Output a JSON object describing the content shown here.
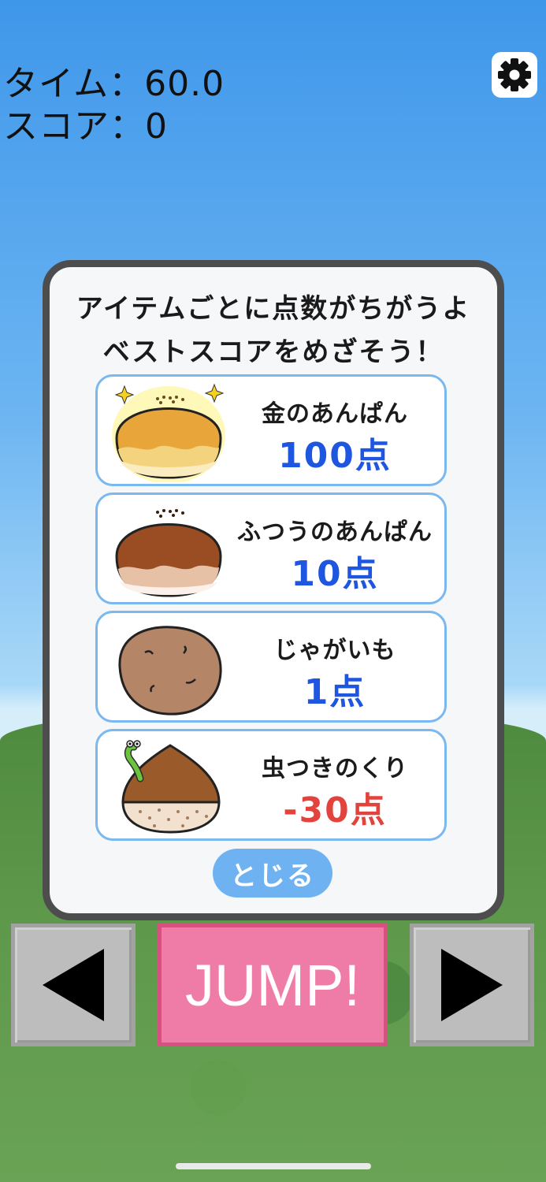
{
  "hud": {
    "time_label": "タイム：60.0",
    "score_label": "スコア：0"
  },
  "settings": {
    "icon": "gear-icon"
  },
  "modal": {
    "heading_line1": "アイテムごとに点数がちがうよ",
    "heading_line2": "ベストスコアをめざそう！",
    "items": [
      {
        "name": "金のあんぱん",
        "points": "100点",
        "color": "#1f56e0",
        "icon": "golden-anpan-icon"
      },
      {
        "name": "ふつうのあんぱん",
        "points": "10点",
        "color": "#1f56e0",
        "icon": "anpan-icon"
      },
      {
        "name": "じゃがいも",
        "points": "1点",
        "color": "#1f56e0",
        "icon": "potato-icon"
      },
      {
        "name": "虫つきのくり",
        "points": "-30点",
        "color": "#e2433d",
        "icon": "wormy-chestnut-icon"
      }
    ],
    "close_label": "とじる"
  },
  "controls": {
    "left_icon": "left-arrow-icon",
    "jump_label": "JUMP!",
    "right_icon": "right-arrow-icon"
  }
}
